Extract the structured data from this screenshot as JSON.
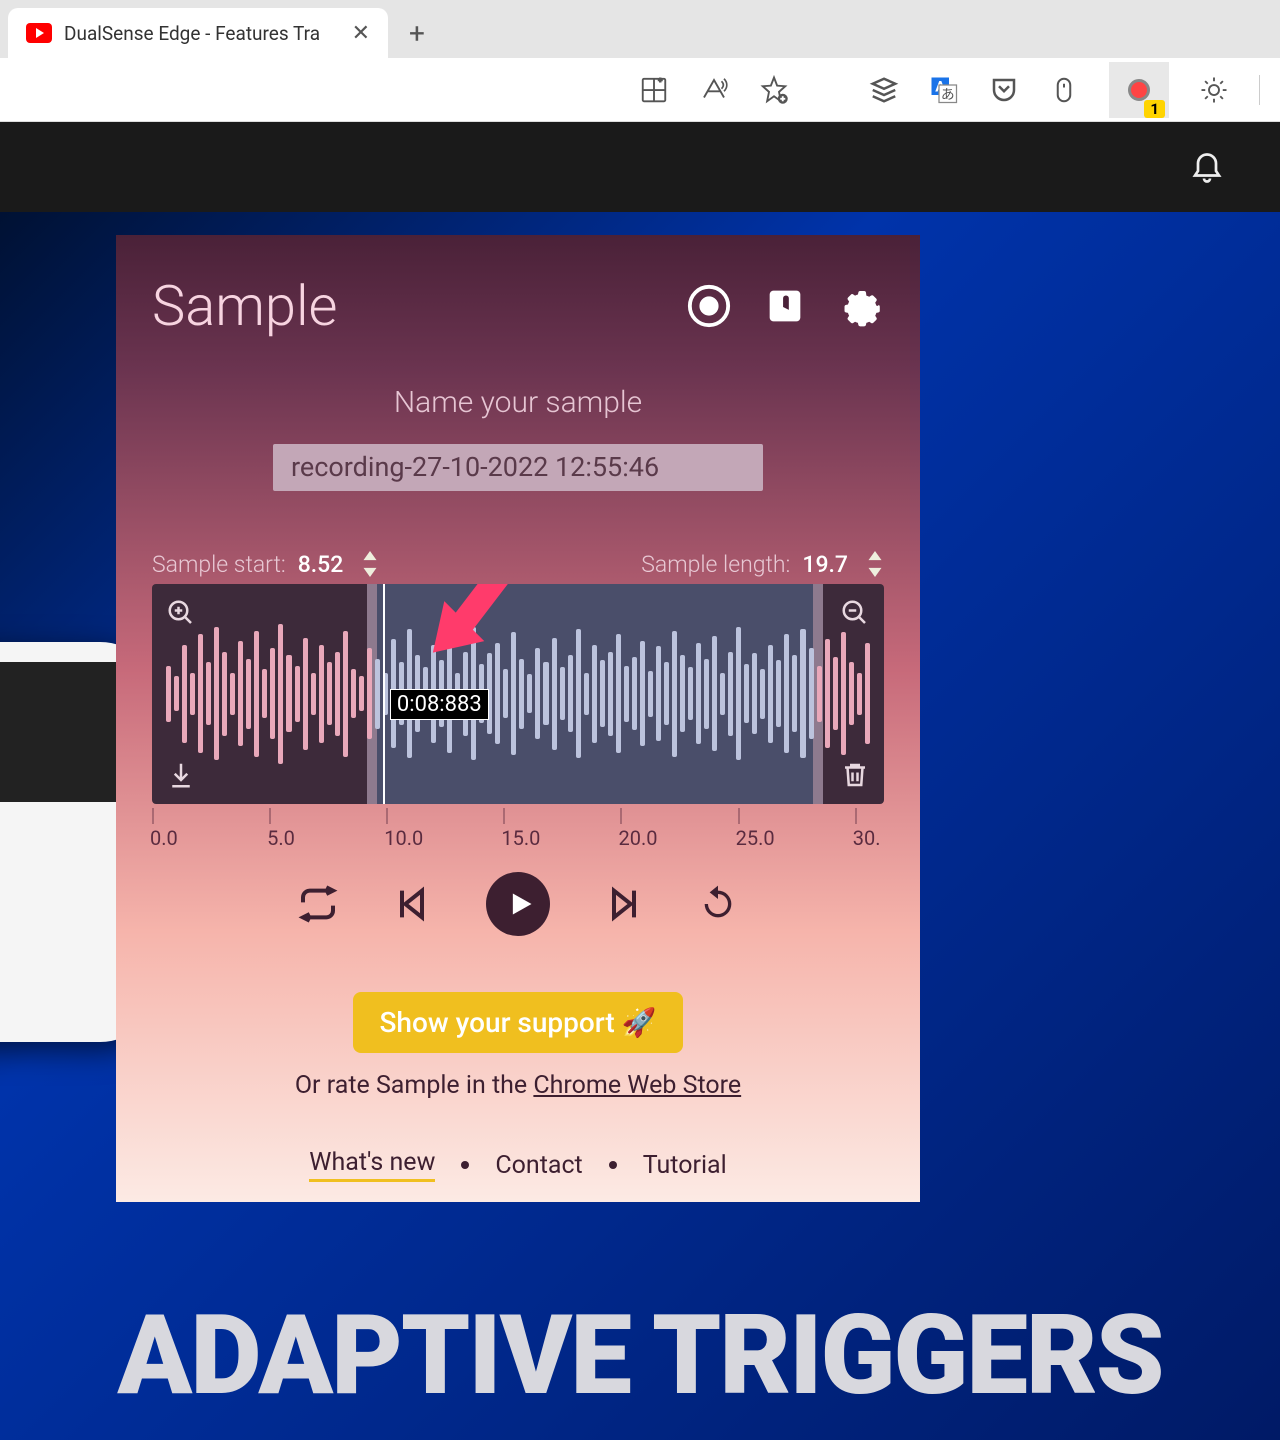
{
  "browser": {
    "tab_title": "DualSense Edge - Features Tra",
    "extension_badge": "1"
  },
  "background": {
    "headline": "ADAPTIVE TRIGGERS"
  },
  "popup": {
    "title": "Sample",
    "name_prompt": "Name your sample",
    "sample_name": "recording-27-10-2022 12:55:46",
    "start_label": "Sample start:",
    "start_value": "8.52",
    "length_label": "Sample length:",
    "length_value": "19.7",
    "timestamp": "0:08:883",
    "ruler_ticks": [
      "0.0",
      "5.0",
      "10.0",
      "15.0",
      "20.0",
      "25.0",
      "30."
    ],
    "support_button": "Show your support 🚀",
    "rate_prefix": "Or rate Sample in the ",
    "rate_link": "Chrome Web Store",
    "footer": {
      "whats_new": "What's new",
      "contact": "Contact",
      "tutorial": "Tutorial"
    }
  }
}
